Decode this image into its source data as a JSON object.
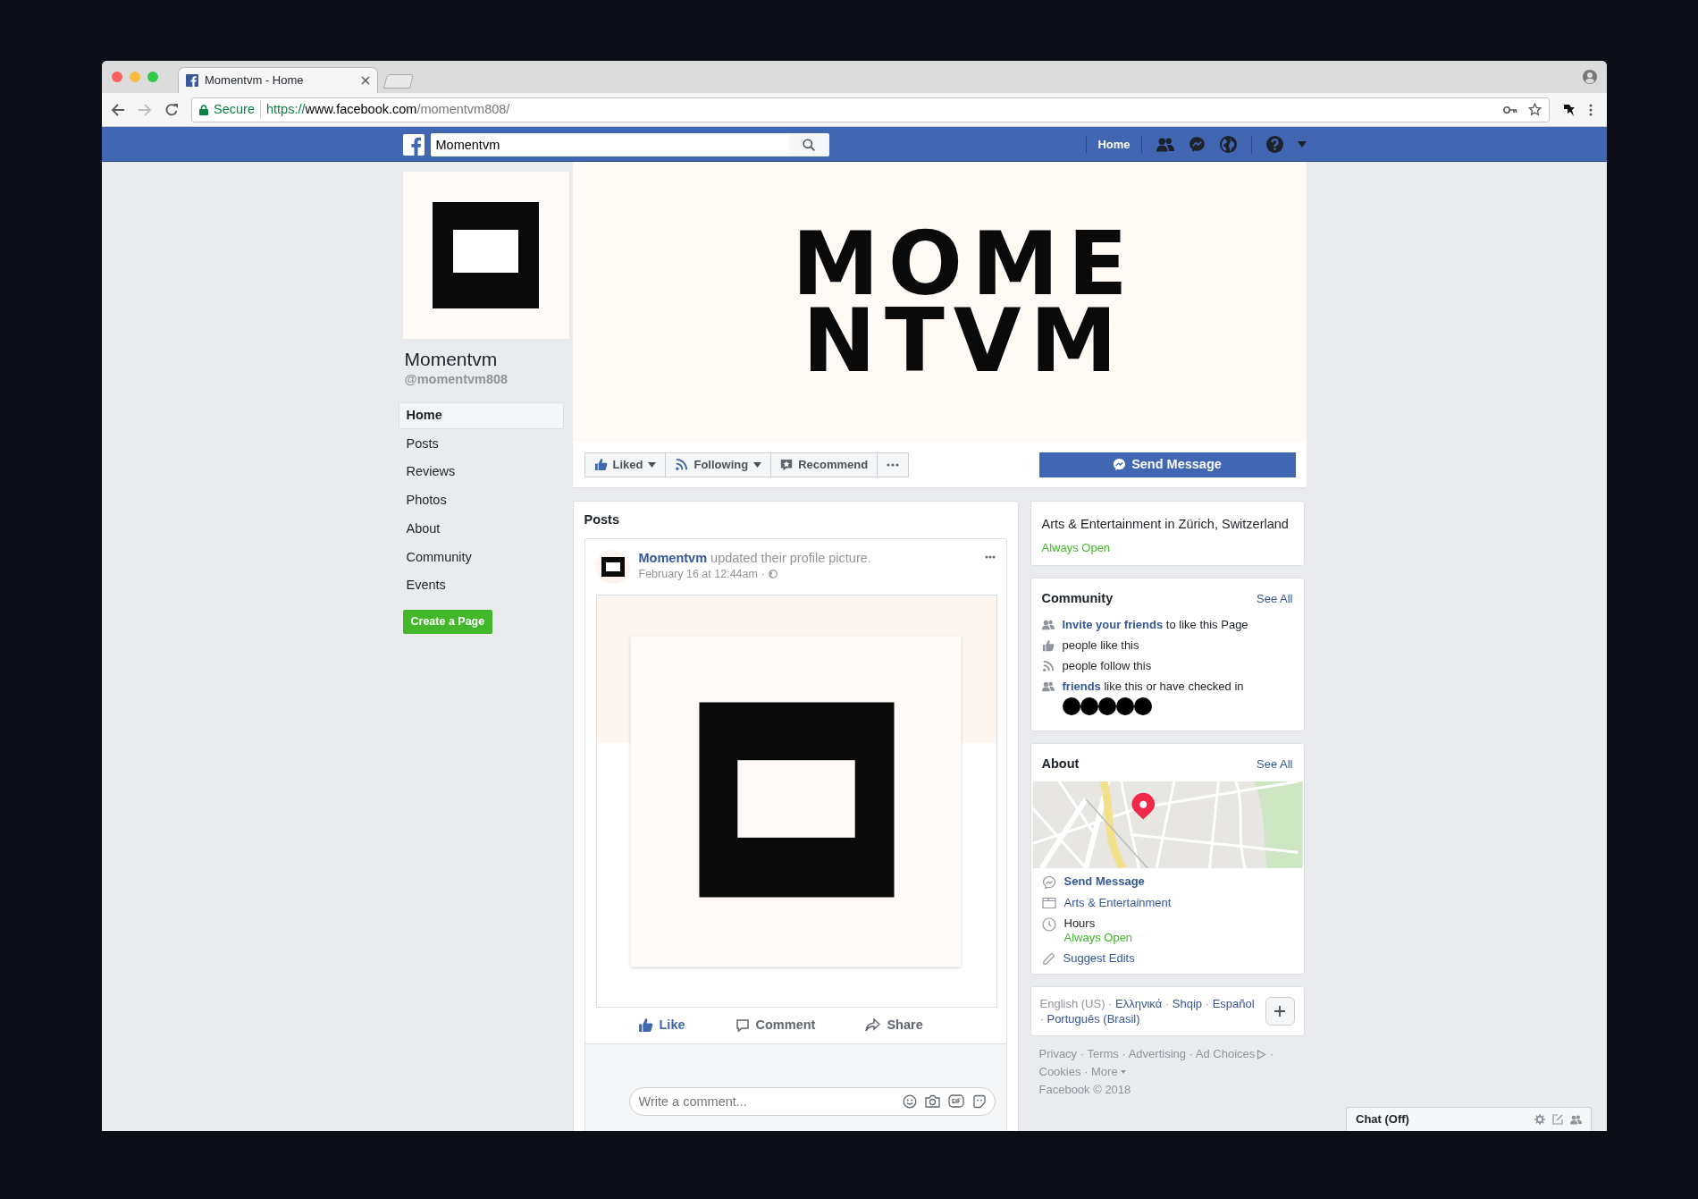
{
  "browser": {
    "tab_title": "Momentvm - Home",
    "secure_label": "Secure",
    "url_scheme": "https://",
    "url_host": "www.facebook.com",
    "url_path": "/momentvm808/"
  },
  "topbar": {
    "search_value": "Momentvm",
    "home_link": "Home"
  },
  "cover": {
    "logo_lines": [
      "MOME",
      "NTVM"
    ]
  },
  "page": {
    "name": "Momentvm",
    "handle": "@momentvm808"
  },
  "sidebar": {
    "items": [
      {
        "label": "Home",
        "selected": true
      },
      {
        "label": "Posts",
        "selected": false
      },
      {
        "label": "Reviews",
        "selected": false
      },
      {
        "label": "Photos",
        "selected": false
      },
      {
        "label": "About",
        "selected": false
      },
      {
        "label": "Community",
        "selected": false
      },
      {
        "label": "Events",
        "selected": false
      }
    ],
    "create_button": "Create a Page"
  },
  "actions": [
    {
      "kind": "liked",
      "label": "Liked",
      "dropdown": true
    },
    {
      "kind": "following",
      "label": "Following",
      "dropdown": true
    },
    {
      "kind": "recommend",
      "label": "Recommend",
      "dropdown": false
    },
    {
      "kind": "more",
      "dropdown": false
    }
  ],
  "send_message": "Send Message",
  "posts": {
    "title": "Posts",
    "post": {
      "author": "Momentvm",
      "action": "updated their profile picture.",
      "time": "February 16 at 12:44am ·",
      "actions": [
        {
          "kind": "like",
          "label": "Like"
        },
        {
          "kind": "comment",
          "label": "Comment"
        },
        {
          "kind": "share",
          "label": "Share"
        }
      ],
      "comment_placeholder": "Write a comment..."
    }
  },
  "info": {
    "category": "Arts & Entertainment in Zürich, Switzerland",
    "status": "Always Open"
  },
  "community": {
    "title": "Community",
    "see_all": "See All",
    "rows": [
      {
        "kind": "friends",
        "link": "Invite your friends",
        "text": "to like this Page",
        "avatars": false
      },
      {
        "kind": "like",
        "text": "people like this",
        "avatars": false
      },
      {
        "kind": "follow",
        "text": "people follow this",
        "avatars": false
      },
      {
        "kind": "friends",
        "link": "friends",
        "text": "like this or have checked in",
        "avatars": true
      }
    ]
  },
  "about": {
    "title": "About",
    "see_all": "See All",
    "rows": [
      {
        "kind": "messenger",
        "link": "Send Message",
        "bold": true
      },
      {
        "kind": "category",
        "link": "Arts & Entertainment",
        "bold": false
      },
      {
        "kind": "clock",
        "text": "Hours",
        "status": "Always Open"
      },
      {
        "kind": "pencil",
        "link": "Suggest Edits",
        "bold": false
      }
    ]
  },
  "languages": {
    "items": [
      {
        "label": "English (US)",
        "current": true,
        "sep": "·"
      },
      {
        "label": "Ελληνικά",
        "current": false,
        "sep": "·"
      },
      {
        "label": "Shqip",
        "current": false,
        "sep": "·"
      },
      {
        "label": "Español",
        "current": false,
        "sep": "·"
      },
      {
        "label": "Português (Brasil)",
        "current": false
      }
    ]
  },
  "footer": {
    "links": [
      {
        "label": "Privacy",
        "sep": "·"
      },
      {
        "label": "Terms",
        "sep": "·"
      },
      {
        "label": "Advertising",
        "sep": "·"
      },
      {
        "label": "Ad Choices",
        "sep": "·",
        "adchoices": true
      },
      {
        "label": "Cookies",
        "sep": "·"
      },
      {
        "label": "More",
        "caret": true
      }
    ],
    "copyright": "Facebook © 2018"
  },
  "chat": {
    "label": "Chat (Off)"
  }
}
